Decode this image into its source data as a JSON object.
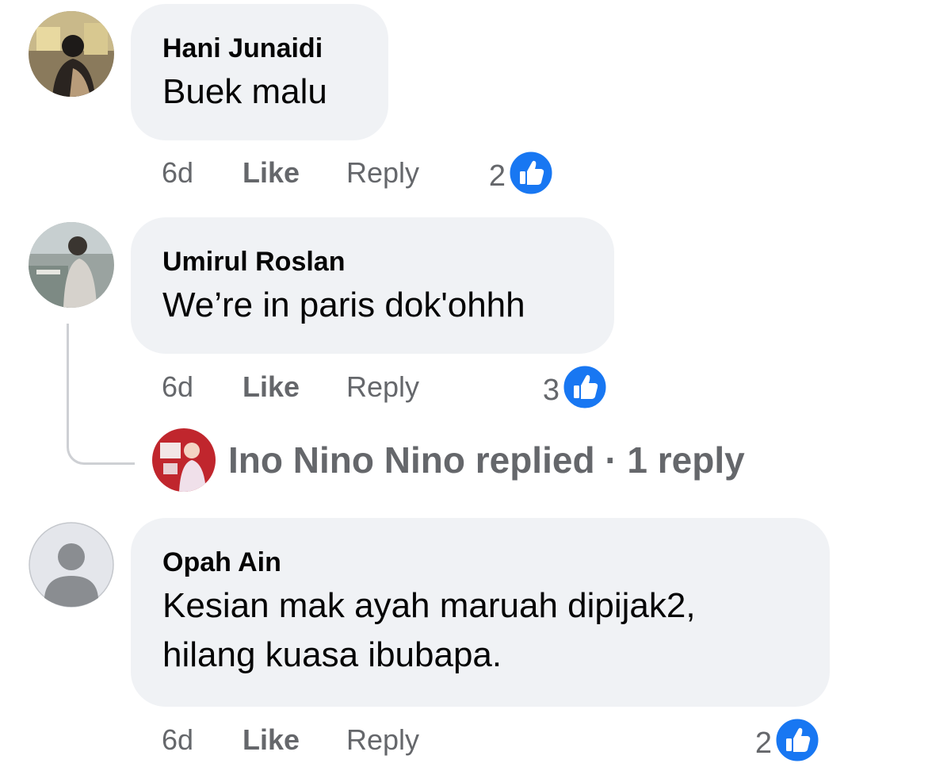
{
  "comments": [
    {
      "author": "Hani Junaidi",
      "text": "Buek malu",
      "time": "6d",
      "like_label": "Like",
      "reply_label": "Reply",
      "reactions": "2"
    },
    {
      "author": "Umirul Roslan",
      "text": "We’re in paris dok'ohhh",
      "time": "6d",
      "like_label": "Like",
      "reply_label": "Reply",
      "reactions": "3",
      "replies_summary": "Ino Nino Nino replied · 1 reply"
    },
    {
      "author": "Opah Ain",
      "text_lines": [
        "Kesian mak ayah maruah dipijak2,",
        "hilang kuasa ibubapa."
      ],
      "time": "6d",
      "like_label": "Like",
      "reply_label": "Reply",
      "reactions": "2"
    }
  ],
  "colors": {
    "bubble": "#f0f2f5",
    "meta_text": "#65676b",
    "like_blue": "#1877f2",
    "thread_line": "#ced0d4"
  },
  "icons": [
    "like-reaction-icon",
    "default-avatar-icon"
  ]
}
